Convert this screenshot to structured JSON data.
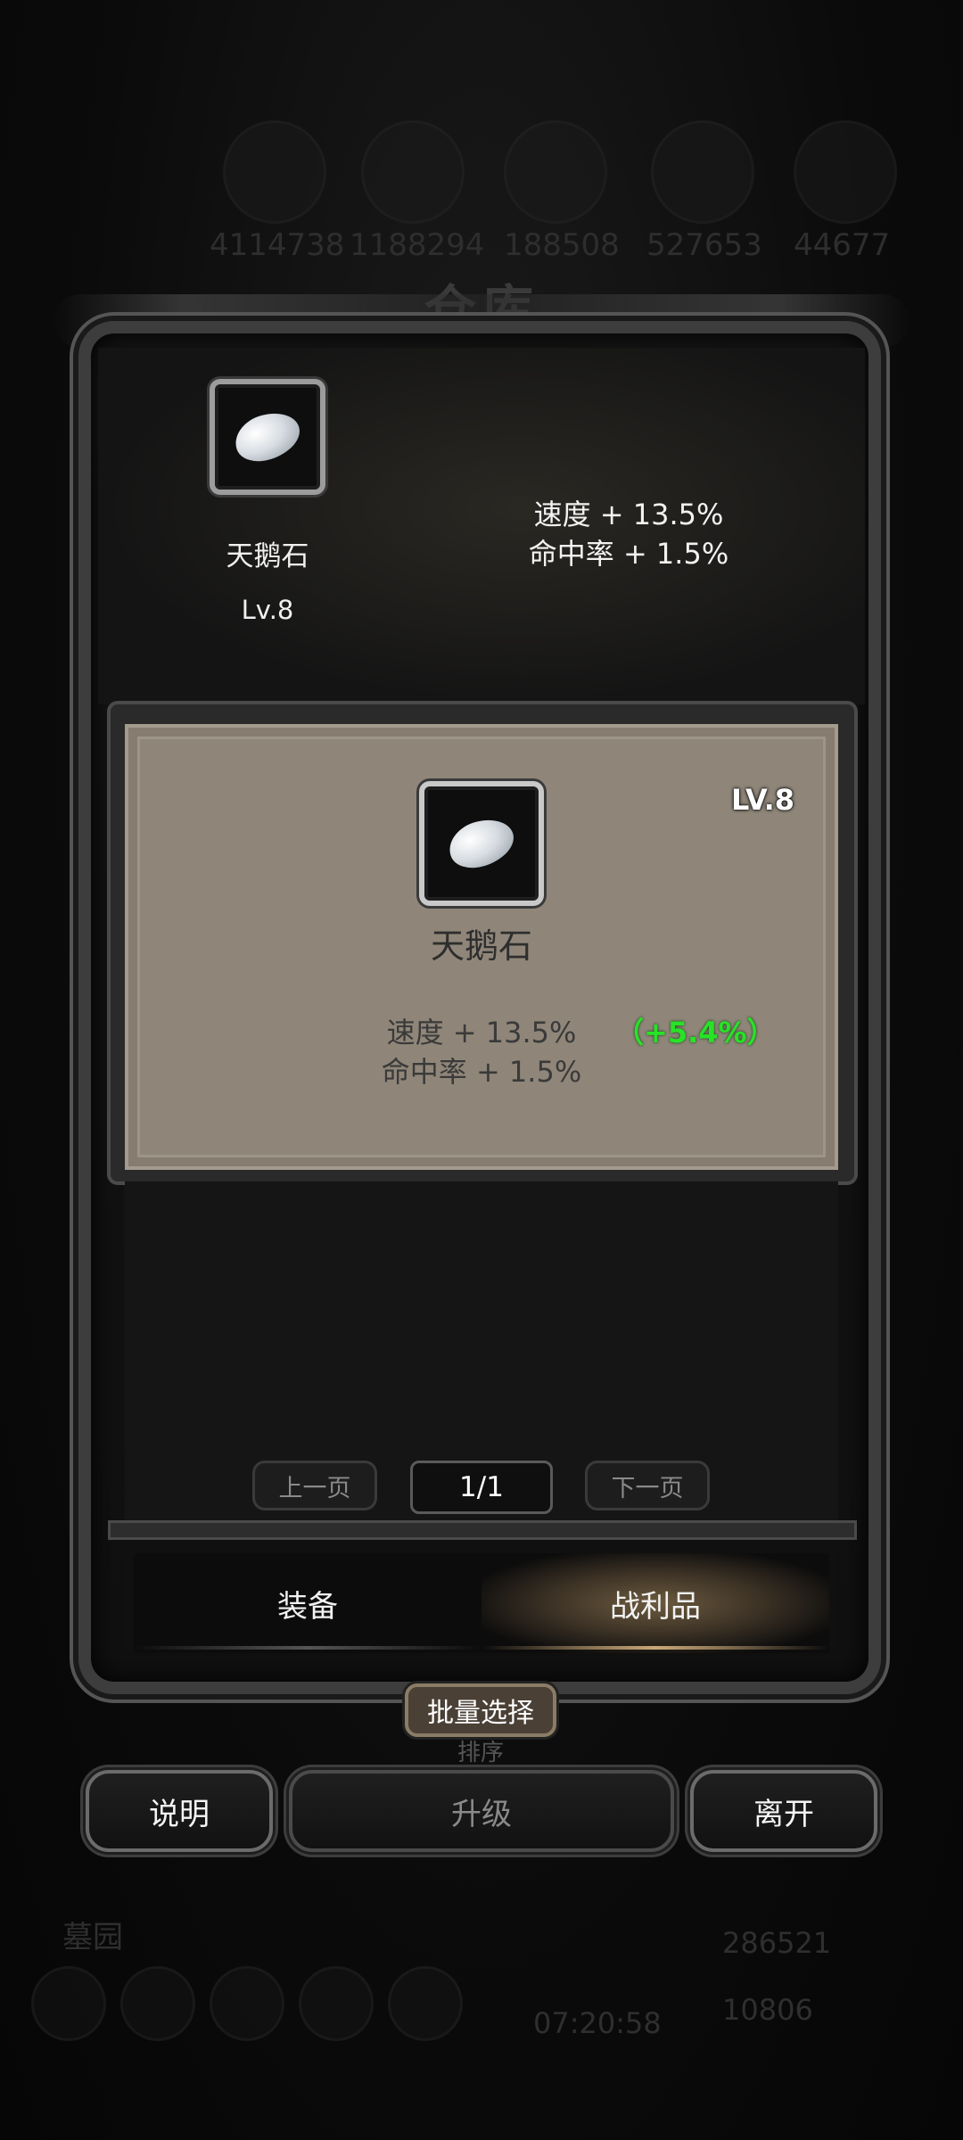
{
  "background": {
    "resources": [
      "4114738",
      "1188294",
      "188508",
      "527653",
      "44677"
    ],
    "title": "仓库",
    "footer_label": "墓园",
    "timer": "07:20:58",
    "gold": "286521",
    "gems": "10806"
  },
  "top_preview": {
    "item_name": "天鹅石",
    "level": "Lv.8",
    "stats": [
      "速度 + 13.5%",
      "命中率 + 1.5%"
    ]
  },
  "detail_card": {
    "level": "LV.8",
    "item_name": "天鹅石",
    "stats": [
      "速度 + 13.5%",
      "命中率 + 1.5%"
    ],
    "bonus": "（+5.4%）"
  },
  "pager": {
    "prev_label": "上一页",
    "page": "1/1",
    "next_label": "下一页"
  },
  "tabs": [
    {
      "label": "装备",
      "active": false
    },
    {
      "label": "战利品",
      "active": true
    }
  ],
  "batch_select_label": "批量选择",
  "sort_label": "排序",
  "buttons": {
    "help": "说明",
    "upgrade": "升级",
    "leave": "离开"
  },
  "colors": {
    "bonus_green": "#27e327",
    "card_bg": "#8f8679",
    "active_tab_glow": "#6b5a3e"
  }
}
